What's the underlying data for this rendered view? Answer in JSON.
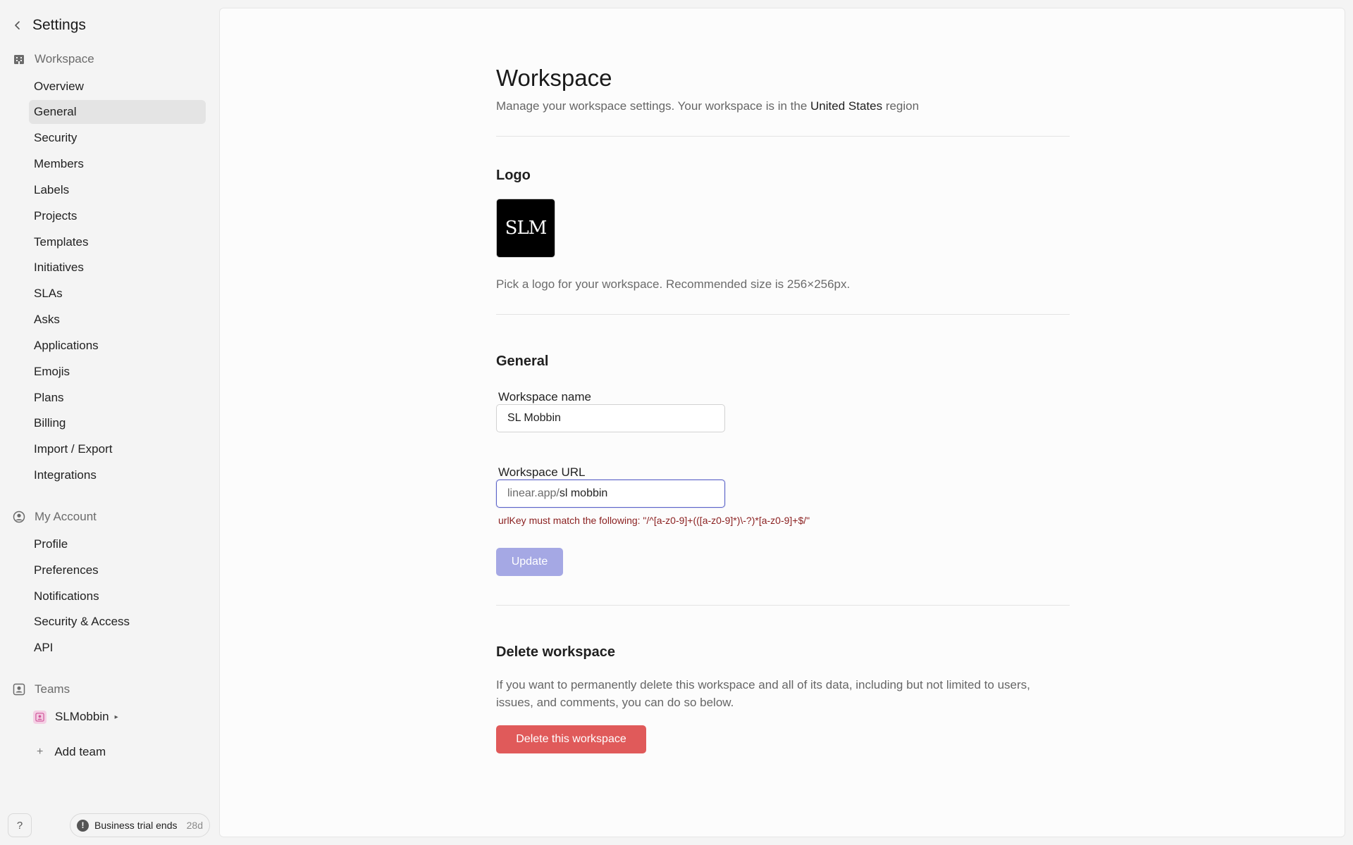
{
  "sidebar": {
    "header": {
      "back_icon": "chevron-left-icon",
      "title": "Settings"
    },
    "workspace": {
      "heading": "Workspace",
      "icon": "building-icon",
      "items": [
        {
          "label": "Overview"
        },
        {
          "label": "General",
          "active": true
        },
        {
          "label": "Security"
        },
        {
          "label": "Members"
        },
        {
          "label": "Labels"
        },
        {
          "label": "Projects"
        },
        {
          "label": "Templates"
        },
        {
          "label": "Initiatives"
        },
        {
          "label": "SLAs"
        },
        {
          "label": "Asks"
        },
        {
          "label": "Applications"
        },
        {
          "label": "Emojis"
        },
        {
          "label": "Plans"
        },
        {
          "label": "Billing"
        },
        {
          "label": "Import / Export"
        },
        {
          "label": "Integrations"
        }
      ]
    },
    "account": {
      "heading": "My Account",
      "icon": "user-circle-icon",
      "items": [
        {
          "label": "Profile"
        },
        {
          "label": "Preferences"
        },
        {
          "label": "Notifications"
        },
        {
          "label": "Security & Access"
        },
        {
          "label": "API"
        }
      ]
    },
    "teams": {
      "heading": "Teams",
      "icon": "team-icon",
      "items": [
        {
          "label": "SLMobbin",
          "caret": "▸"
        }
      ],
      "add_label": "Add team"
    },
    "footer": {
      "help_label": "?",
      "trial_label": "Business trial ends",
      "trial_days": "28d"
    }
  },
  "main": {
    "title": "Workspace",
    "subtitle_prefix": "Manage your workspace settings. Your workspace is in the ",
    "region": "United States",
    "subtitle_suffix": " region",
    "logo": {
      "section_title": "Logo",
      "logo_text": "SLM",
      "hint": "Pick a logo for your workspace. Recommended size is 256×256px."
    },
    "general": {
      "section_title": "General",
      "name_label": "Workspace name",
      "name_value": "SL Mobbin",
      "url_label": "Workspace URL",
      "url_prefix": "linear.app/",
      "url_value": "sl mobbin",
      "error": "urlKey must match the following: \"/^[a-z0-9]+(([a-z0-9]*)\\-?)*[a-z0-9]+$/\"",
      "update_label": "Update"
    },
    "delete": {
      "section_title": "Delete workspace",
      "description": "If you want to permanently delete this workspace and all of its data, including but not limited to users, issues, and comments, you can do so below.",
      "button_label": "Delete this workspace"
    }
  },
  "colors": {
    "accent": "#5b63c8",
    "update_disabled": "#a5a8e4",
    "danger": "#e05a5a",
    "error_text": "#8a1f1f"
  }
}
